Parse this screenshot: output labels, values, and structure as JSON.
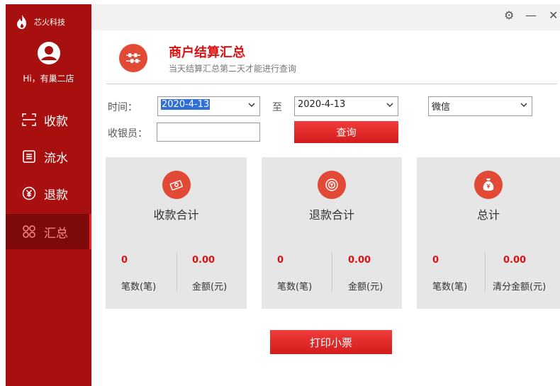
{
  "brand": {
    "name": "芯火科技"
  },
  "user": {
    "greeting": "Hi，有巢二店"
  },
  "nav": [
    {
      "label": "收款",
      "icon": "scan-icon"
    },
    {
      "label": "流水",
      "icon": "list-icon"
    },
    {
      "label": "退款",
      "icon": "yuan-circle-icon"
    },
    {
      "label": "汇总",
      "icon": "grid-icon",
      "active": true
    }
  ],
  "window_controls": {
    "settings": "⚙",
    "minimize": "—",
    "close": "✕"
  },
  "header": {
    "title": "商户结算汇总",
    "subtitle": "当天结算汇总第二天才能进行查询"
  },
  "filters": {
    "time_label": "时间：",
    "start_date": "2020-4-13",
    "to_label": "至",
    "end_date": "2020-4-13",
    "payment_method": "微信",
    "cashier_label": "收银员：",
    "cashier_value": "",
    "query_label": "查询"
  },
  "cards": [
    {
      "title": "收款合计",
      "count": "0",
      "amount": "0.00",
      "count_label": "笔数(笔)",
      "amount_label": "金额(元)"
    },
    {
      "title": "退款合计",
      "count": "0",
      "amount": "0.00",
      "count_label": "笔数(笔)",
      "amount_label": "金额(元)"
    },
    {
      "title": "总计",
      "count": "0",
      "amount": "0.00",
      "count_label": "笔数(笔)",
      "amount_label": "清分金额(元)"
    }
  ],
  "print_label": "打印小票",
  "colors": {
    "sidebar": "#a80f0f",
    "accent": "#e03030",
    "active_nav": "#7d0909"
  }
}
